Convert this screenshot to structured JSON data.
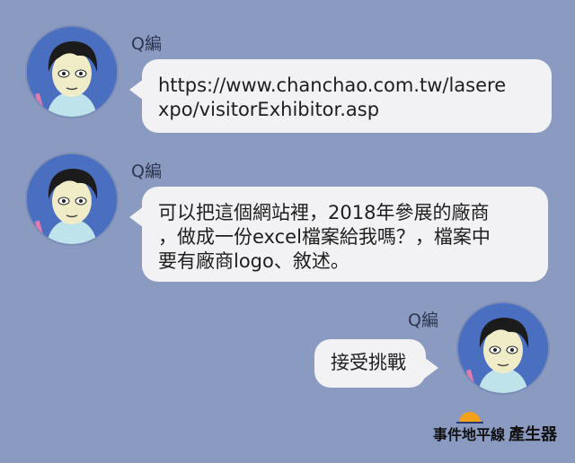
{
  "messages": [
    {
      "sender": "Q編",
      "align": "left",
      "lines": [
        "https://www.chanchao.com.tw/lasere",
        "xpo/visitorExhibitor.asp"
      ]
    },
    {
      "sender": "Q編",
      "align": "left",
      "lines": [
        "可以把這個網站裡，2018年參展的廠商",
        "，做成一份excel檔案給我嗎？，檔案中",
        "要有廠商logo、敘述。"
      ]
    },
    {
      "sender": "Q編",
      "align": "right",
      "lines": [
        "接受挑戰"
      ]
    }
  ],
  "brand": {
    "part1": "事件地平線",
    "part2": "產生器"
  },
  "colors": {
    "background": "#8a9ac0",
    "bubble": "#f2f2f4",
    "avatar_bg": "#4a6fc0"
  },
  "icons": {
    "avatar": "cartoon-avatar-icon",
    "brand_logo": "sun-horizon-logo-icon"
  }
}
